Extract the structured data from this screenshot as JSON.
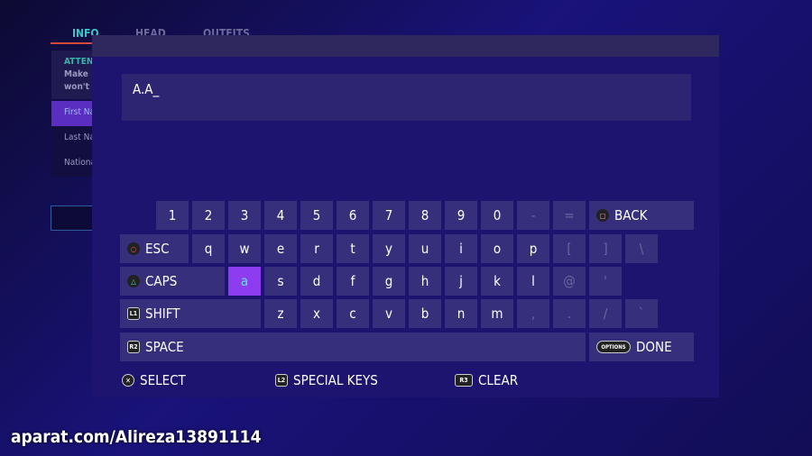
{
  "background": {
    "tabs": [
      "INFO",
      "HEAD",
      "OUTFITS"
    ],
    "attention_title": "ATTEN",
    "attention_lines": [
      "Make",
      "won't"
    ],
    "fields": [
      "First Na",
      "Last Na",
      "Nationa"
    ]
  },
  "input": {
    "value": "A.A_"
  },
  "keyboard": {
    "rows": [
      [
        "1",
        "2",
        "3",
        "4",
        "5",
        "6",
        "7",
        "8",
        "9",
        "0",
        "-",
        "=",
        "BACK"
      ],
      [
        "ESC",
        "q",
        "w",
        "e",
        "r",
        "t",
        "y",
        "u",
        "i",
        "o",
        "p",
        "[",
        "]",
        "\\"
      ],
      [
        "CAPS",
        "a",
        "s",
        "d",
        "f",
        "g",
        "h",
        "j",
        "k",
        "l",
        "@",
        "'"
      ],
      [
        "SHIFT",
        "z",
        "x",
        "c",
        "v",
        "b",
        "n",
        "m",
        ",",
        ".",
        "/",
        "`"
      ],
      [
        "SPACE",
        "DONE"
      ]
    ],
    "selected_key": "a",
    "button_icons": {
      "BACK": "square-button-icon",
      "ESC": "circle-button-icon",
      "CAPS": "triangle-button-icon",
      "SHIFT": "l1-button-icon",
      "SPACE": "r2-button-icon",
      "DONE": "options-button-icon"
    },
    "button_glyphs": {
      "BACK": "□",
      "ESC": "○",
      "CAPS": "△",
      "SHIFT": "L1",
      "SPACE": "R2",
      "DONE": "OPTIONS"
    }
  },
  "footer": [
    {
      "glyph": "✕",
      "label": "SELECT",
      "icon": "cross-button-icon"
    },
    {
      "glyph": "L2",
      "label": "SPECIAL KEYS",
      "icon": "l2-button-icon"
    },
    {
      "glyph": "R3",
      "label": "CLEAR",
      "icon": "r3-button-icon"
    }
  ],
  "watermark": "aparat.com/Alireza13891114",
  "colors": {
    "selected_key": "#8d3cf0",
    "dialog": "#1d1470",
    "key": "#36307c",
    "accent": "#37c7c7"
  }
}
